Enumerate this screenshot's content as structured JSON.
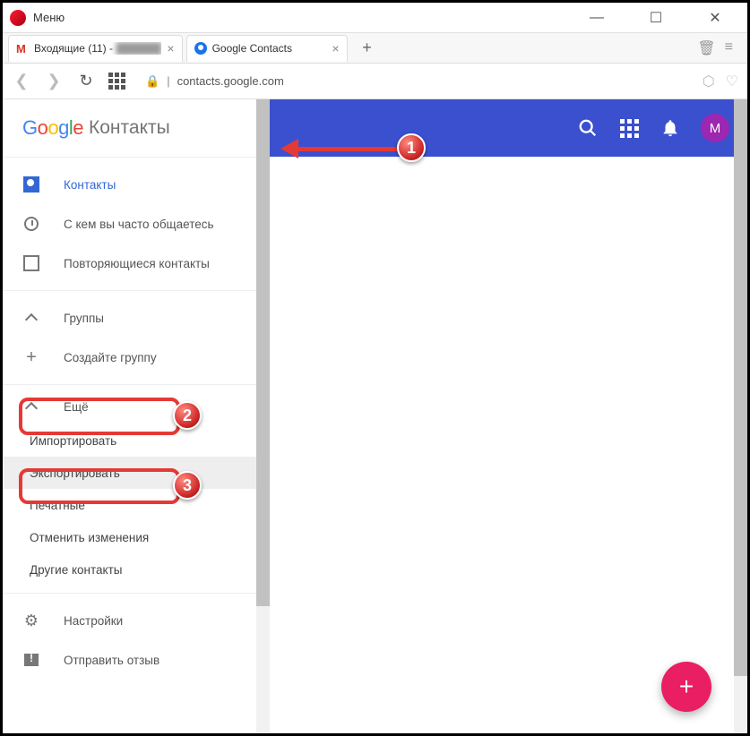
{
  "window": {
    "menu": "Меню",
    "controls": {
      "min": "—",
      "max": "☐",
      "close": "✕"
    }
  },
  "tabs": {
    "tab1": {
      "title": "Входящие (11) -",
      "obscured": "██████"
    },
    "tab2": {
      "title": "Google Contacts"
    },
    "close": "×",
    "new": "+"
  },
  "address": {
    "back": "❮",
    "fwd": "❯",
    "reload": "↻",
    "lock": "🔒",
    "url": "contacts.google.com",
    "shield": "⬡",
    "heart": "♡"
  },
  "sidebar": {
    "logo": {
      "g": "G",
      "o1": "o",
      "o2": "o",
      "g2": "g",
      "l": "l",
      "e": "e"
    },
    "app": "Контакты",
    "contacts": "Контакты",
    "frequent": "С кем вы часто общаетесь",
    "duplicates": "Повторяющиеся контакты",
    "groups": "Группы",
    "create_group": "Создайте группу",
    "more": "Ещё",
    "import": "Импортировать",
    "export": "Экспортировать",
    "print": "Печатные",
    "undo": "Отменить изменения",
    "other": "Другие контакты",
    "settings": "Настройки",
    "feedback": "Отправить отзыв"
  },
  "header": {
    "search": "🔍",
    "bell": "🔔",
    "avatar": "M"
  },
  "fab": "+",
  "badges": {
    "b1": "1",
    "b2": "2",
    "b3": "3"
  },
  "tabstrip_right": {
    "trash": "🗑",
    "menu": "≡"
  }
}
